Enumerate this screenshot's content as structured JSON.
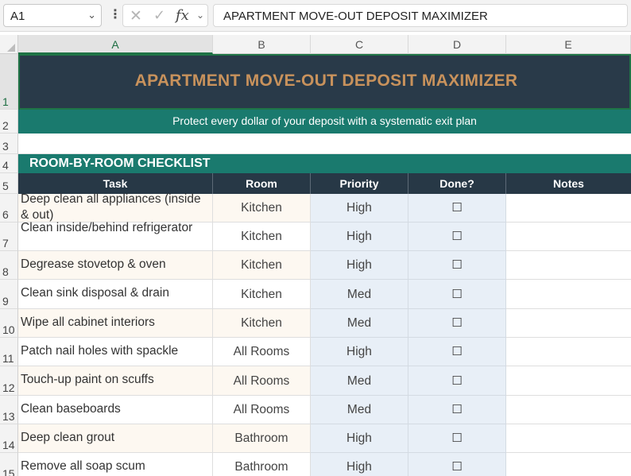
{
  "formula_bar": {
    "name_box": "A1",
    "formula": "APARTMENT MOVE-OUT DEPOSIT MAXIMIZER",
    "fx_label": "fx"
  },
  "columns": [
    "A",
    "B",
    "C",
    "D",
    "E"
  ],
  "rows": [
    "1",
    "2",
    "3",
    "4",
    "5",
    "6",
    "7",
    "8",
    "9",
    "10",
    "11",
    "12",
    "13",
    "14",
    "15"
  ],
  "sheet": {
    "title": "APARTMENT MOVE-OUT DEPOSIT MAXIMIZER",
    "subtitle": "Protect every dollar of your deposit with a systematic exit plan",
    "section": "ROOM-BY-ROOM CHECKLIST",
    "headers": [
      "Task",
      "Room",
      "Priority",
      "Done?",
      "Notes"
    ],
    "checkbox_glyph": "☐",
    "tasks": [
      {
        "task": "Deep clean all appliances (inside & out)",
        "room": "Kitchen",
        "priority": "High"
      },
      {
        "task": "Clean inside/behind refrigerator",
        "room": "Kitchen",
        "priority": "High"
      },
      {
        "task": "Degrease stovetop & oven",
        "room": "Kitchen",
        "priority": "High"
      },
      {
        "task": "Clean sink disposal & drain",
        "room": "Kitchen",
        "priority": "Med"
      },
      {
        "task": "Wipe all cabinet interiors",
        "room": "Kitchen",
        "priority": "Med"
      },
      {
        "task": "Patch nail holes with spackle",
        "room": "All Rooms",
        "priority": "High"
      },
      {
        "task": "Touch-up paint on scuffs",
        "room": "All Rooms",
        "priority": "Med"
      },
      {
        "task": "Clean baseboards",
        "room": "All Rooms",
        "priority": "Med"
      },
      {
        "task": "Deep clean grout",
        "room": "Bathroom",
        "priority": "High"
      },
      {
        "task": "Remove all soap scum",
        "room": "Bathroom",
        "priority": "High"
      }
    ]
  },
  "colors": {
    "title_bg": "#293a49",
    "title_text": "#c8925c",
    "band_teal": "#1a7a6e",
    "header_dark": "#273846",
    "status_col_bg": "#e8eff7",
    "alt_row_bg": "#fdf8f1"
  }
}
